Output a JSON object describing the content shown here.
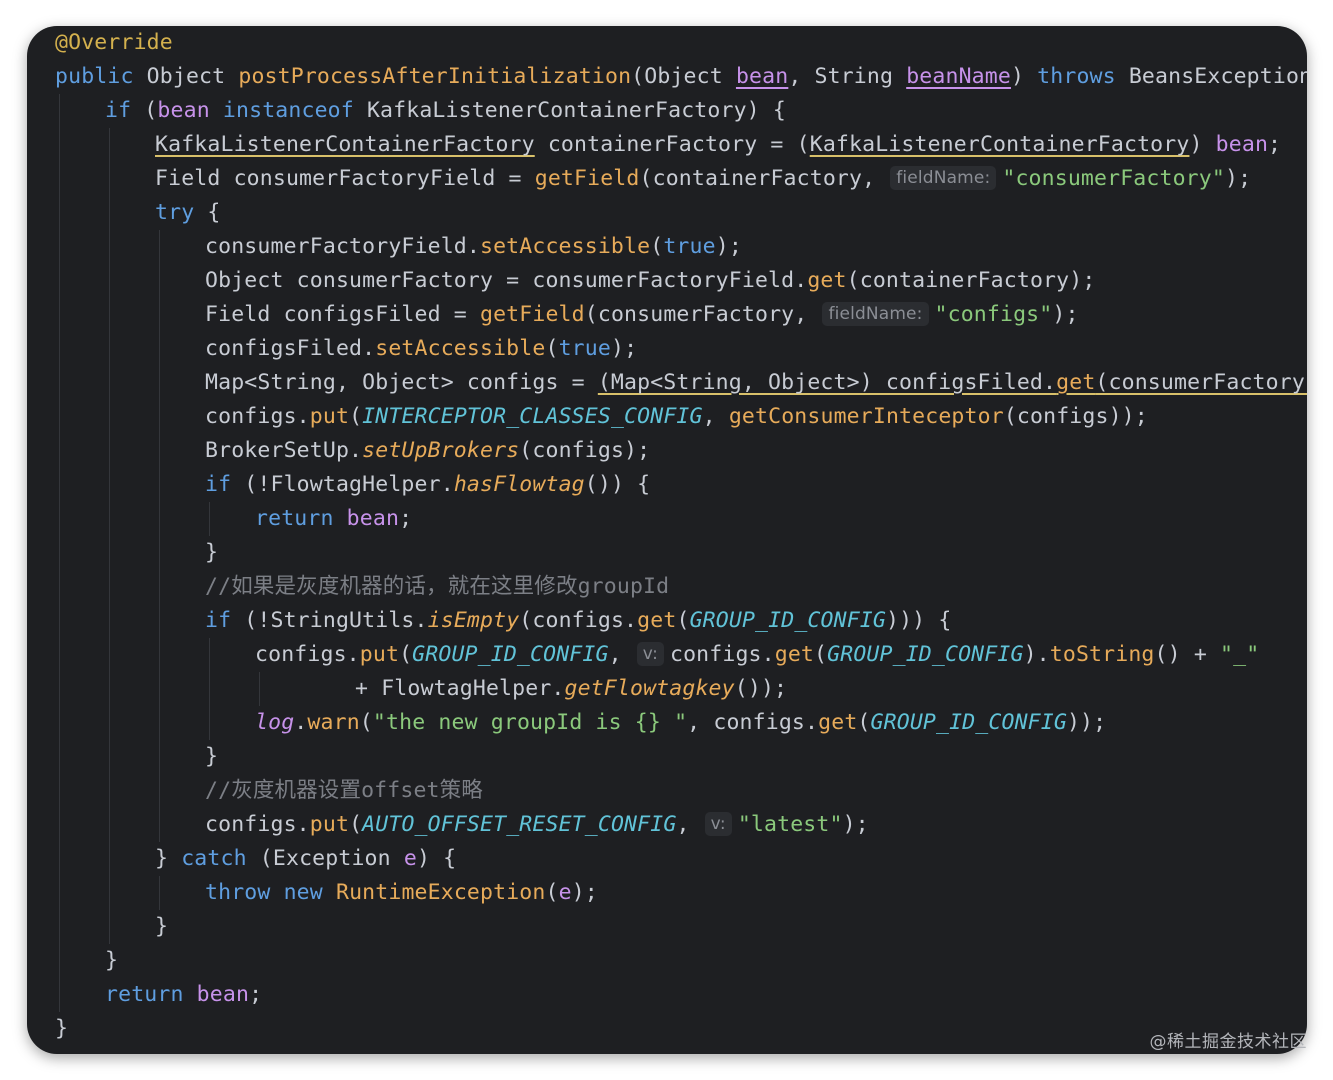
{
  "colors": {
    "background": "#1e1f22",
    "keyword": "#5f9ee0",
    "method": "#e7ab5a",
    "variable": "#c792ea",
    "string": "#8bc97c",
    "constant": "#61c3d8",
    "comment": "#7c7f86",
    "annotation": "#d4b14e",
    "plain": "#c8ccd4"
  },
  "watermark": "@稀土掘金技术社区",
  "lines": [
    {
      "indent": 0,
      "tokens": [
        {
          "t": "@Override",
          "c": "ann"
        }
      ]
    },
    {
      "indent": 0,
      "tokens": [
        {
          "t": "public ",
          "c": "kw"
        },
        {
          "t": "Object "
        },
        {
          "t": "postProcessAfterInitialization",
          "c": "fn"
        },
        {
          "t": "(Object "
        },
        {
          "t": "bean",
          "c": "var",
          "u": "var"
        },
        {
          "t": ", String "
        },
        {
          "t": "beanName",
          "c": "var",
          "u": "var"
        },
        {
          "t": ") "
        },
        {
          "t": "throws ",
          "c": "kw"
        },
        {
          "t": "BeansException {"
        }
      ]
    },
    {
      "indent": 1,
      "tokens": [
        {
          "t": "if ",
          "c": "kw"
        },
        {
          "t": "("
        },
        {
          "t": "bean",
          "c": "var"
        },
        {
          "t": " "
        },
        {
          "t": "instanceof ",
          "c": "kw"
        },
        {
          "t": "KafkaListenerContainerFactory) {"
        }
      ]
    },
    {
      "indent": 2,
      "tokens": [
        {
          "t": "KafkaListenerContainerFactory",
          "u": "warn"
        },
        {
          "t": " containerFactory = ("
        },
        {
          "t": "KafkaListenerContainerFactory",
          "u": "warn"
        },
        {
          "t": ") "
        },
        {
          "t": "bean",
          "c": "var"
        },
        {
          "t": ";"
        }
      ]
    },
    {
      "indent": 2,
      "tokens": [
        {
          "t": "Field consumerFactoryField = "
        },
        {
          "t": "getField",
          "c": "fn"
        },
        {
          "t": "(containerFactory, "
        },
        {
          "hint": "fieldName:"
        },
        {
          "t": "\"consumerFactory\"",
          "c": "str"
        },
        {
          "t": ");"
        }
      ]
    },
    {
      "indent": 2,
      "tokens": [
        {
          "t": "try ",
          "c": "kw"
        },
        {
          "t": "{"
        }
      ]
    },
    {
      "indent": 3,
      "tokens": [
        {
          "t": "consumerFactoryField."
        },
        {
          "t": "setAccessible",
          "c": "fn"
        },
        {
          "t": "("
        },
        {
          "t": "true",
          "c": "kw"
        },
        {
          "t": ");"
        }
      ]
    },
    {
      "indent": 3,
      "tokens": [
        {
          "t": "Object consumerFactory = consumerFactoryField."
        },
        {
          "t": "get",
          "c": "fn"
        },
        {
          "t": "(containerFactory);"
        }
      ]
    },
    {
      "indent": 3,
      "tokens": [
        {
          "t": "Field configsFiled = "
        },
        {
          "t": "getField",
          "c": "fn"
        },
        {
          "t": "(consumerFactory, "
        },
        {
          "hint": "fieldName:"
        },
        {
          "t": "\"configs\"",
          "c": "str"
        },
        {
          "t": ");"
        }
      ]
    },
    {
      "indent": 3,
      "tokens": [
        {
          "t": "configsFiled."
        },
        {
          "t": "setAccessible",
          "c": "fn"
        },
        {
          "t": "("
        },
        {
          "t": "true",
          "c": "kw"
        },
        {
          "t": ");"
        }
      ]
    },
    {
      "indent": 3,
      "tokens": [
        {
          "t": "Map<String, Object> configs = "
        },
        {
          "t": "(Map<String, Object>) configsFiled.",
          "u": "warn"
        },
        {
          "t": "get",
          "c": "fn",
          "u": "warn"
        },
        {
          "t": "(consumerFactory)",
          "u": "warn"
        },
        {
          "t": ";"
        }
      ]
    },
    {
      "indent": 3,
      "tokens": [
        {
          "t": "configs."
        },
        {
          "t": "put",
          "c": "fn"
        },
        {
          "t": "("
        },
        {
          "t": "INTERCEPTOR_CLASSES_CONFIG",
          "c": "cst"
        },
        {
          "t": ", "
        },
        {
          "t": "getConsumerInteceptor",
          "c": "fn"
        },
        {
          "t": "(configs));"
        }
      ]
    },
    {
      "indent": 3,
      "tokens": [
        {
          "t": "BrokerSetUp."
        },
        {
          "t": "setUpBrokers",
          "c": "sfn"
        },
        {
          "t": "(configs);"
        }
      ]
    },
    {
      "indent": 3,
      "tokens": [
        {
          "t": "if ",
          "c": "kw"
        },
        {
          "t": "(!FlowtagHelper."
        },
        {
          "t": "hasFlowtag",
          "c": "sfn"
        },
        {
          "t": "()) {"
        }
      ]
    },
    {
      "indent": 4,
      "tokens": [
        {
          "t": "return ",
          "c": "kw"
        },
        {
          "t": "bean",
          "c": "var"
        },
        {
          "t": ";"
        }
      ]
    },
    {
      "indent": 3,
      "tokens": [
        {
          "t": "}"
        }
      ]
    },
    {
      "indent": 3,
      "tokens": [
        {
          "t": "//如果是灰度机器的话，就在这里修改groupId",
          "c": "cmt"
        }
      ]
    },
    {
      "indent": 3,
      "tokens": [
        {
          "t": "if ",
          "c": "kw"
        },
        {
          "t": "(!StringUtils."
        },
        {
          "t": "isEmpty",
          "c": "sfn"
        },
        {
          "t": "(configs."
        },
        {
          "t": "get",
          "c": "fn"
        },
        {
          "t": "("
        },
        {
          "t": "GROUP_ID_CONFIG",
          "c": "cst"
        },
        {
          "t": "))) {"
        }
      ]
    },
    {
      "indent": 4,
      "tokens": [
        {
          "t": "configs."
        },
        {
          "t": "put",
          "c": "fn"
        },
        {
          "t": "("
        },
        {
          "t": "GROUP_ID_CONFIG",
          "c": "cst"
        },
        {
          "t": ", "
        },
        {
          "hint": "v:"
        },
        {
          "t": "configs."
        },
        {
          "t": "get",
          "c": "fn"
        },
        {
          "t": "("
        },
        {
          "t": "GROUP_ID_CONFIG",
          "c": "cst"
        },
        {
          "t": ")."
        },
        {
          "t": "toString",
          "c": "fn"
        },
        {
          "t": "() + "
        },
        {
          "t": "\"_\"",
          "c": "str"
        }
      ]
    },
    {
      "indent": 6,
      "tokens": [
        {
          "t": "+ FlowtagHelper."
        },
        {
          "t": "getFlowtagkey",
          "c": "sfn"
        },
        {
          "t": "());"
        }
      ]
    },
    {
      "indent": 4,
      "tokens": [
        {
          "t": "log",
          "c": "fld"
        },
        {
          "t": "."
        },
        {
          "t": "warn",
          "c": "fn"
        },
        {
          "t": "("
        },
        {
          "t": "\"the new groupId is {} \"",
          "c": "str"
        },
        {
          "t": ", configs."
        },
        {
          "t": "get",
          "c": "fn"
        },
        {
          "t": "("
        },
        {
          "t": "GROUP_ID_CONFIG",
          "c": "cst"
        },
        {
          "t": "));"
        }
      ]
    },
    {
      "indent": 3,
      "tokens": [
        {
          "t": "}"
        }
      ]
    },
    {
      "indent": 3,
      "tokens": [
        {
          "t": "//灰度机器设置offset策略",
          "c": "cmt"
        }
      ]
    },
    {
      "indent": 3,
      "tokens": [
        {
          "t": "configs."
        },
        {
          "t": "put",
          "c": "fn"
        },
        {
          "t": "("
        },
        {
          "t": "AUTO_OFFSET_RESET_CONFIG",
          "c": "cst"
        },
        {
          "t": ", "
        },
        {
          "hint": "v:"
        },
        {
          "t": "\"latest\"",
          "c": "str"
        },
        {
          "t": ");"
        }
      ]
    },
    {
      "indent": 2,
      "tokens": [
        {
          "t": "} "
        },
        {
          "t": "catch ",
          "c": "kw"
        },
        {
          "t": "(Exception "
        },
        {
          "t": "e",
          "c": "var"
        },
        {
          "t": ") {"
        }
      ]
    },
    {
      "indent": 3,
      "tokens": [
        {
          "t": "throw ",
          "c": "kw"
        },
        {
          "t": "new ",
          "c": "kw"
        },
        {
          "t": "RuntimeException",
          "c": "fn"
        },
        {
          "t": "("
        },
        {
          "t": "e",
          "c": "var"
        },
        {
          "t": ");"
        }
      ]
    },
    {
      "indent": 2,
      "tokens": [
        {
          "t": "}"
        }
      ]
    },
    {
      "indent": 1,
      "tokens": [
        {
          "t": "}"
        }
      ]
    },
    {
      "indent": 1,
      "tokens": [
        {
          "t": "return ",
          "c": "kw"
        },
        {
          "t": "bean",
          "c": "var"
        },
        {
          "t": ";"
        }
      ]
    },
    {
      "indent": 0,
      "tokens": [
        {
          "t": "}"
        }
      ]
    }
  ]
}
